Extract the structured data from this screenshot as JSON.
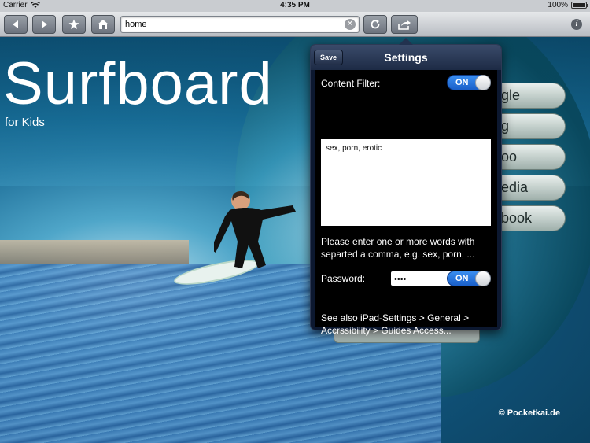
{
  "statusbar": {
    "carrier": "Carrier",
    "time": "4:35 PM",
    "battery": "100%",
    "battery_level": 1.0
  },
  "toolbar": {
    "back_icon": "back-arrow-icon",
    "forward_icon": "forward-arrow-icon",
    "bookmark_icon": "star-icon",
    "home_icon": "home-icon",
    "url_value": "home",
    "reload_icon": "reload-icon",
    "share_icon": "share-icon",
    "info_icon": "info-icon"
  },
  "hero": {
    "title": "Surfboard",
    "subtitle": "for Kids",
    "copyright": "© Pocketkai.de"
  },
  "search_buttons": [
    "ogle",
    "ng",
    "hoo",
    "pedia",
    "ebook"
  ],
  "settings": {
    "save_label": "Save",
    "title": "Settings",
    "content_filter_label": "Content Filter:",
    "content_filter_toggle": "ON",
    "filter_words": "sex, porn, erotic",
    "instructions": "Please enter one or more words with separted a comma, e.g. sex, porn, ...",
    "password_label": "Password:",
    "password_value": "••••",
    "password_toggle": "ON",
    "see_also": "See also iPad-Settings > General > Accrssibility > Guides Access..."
  }
}
